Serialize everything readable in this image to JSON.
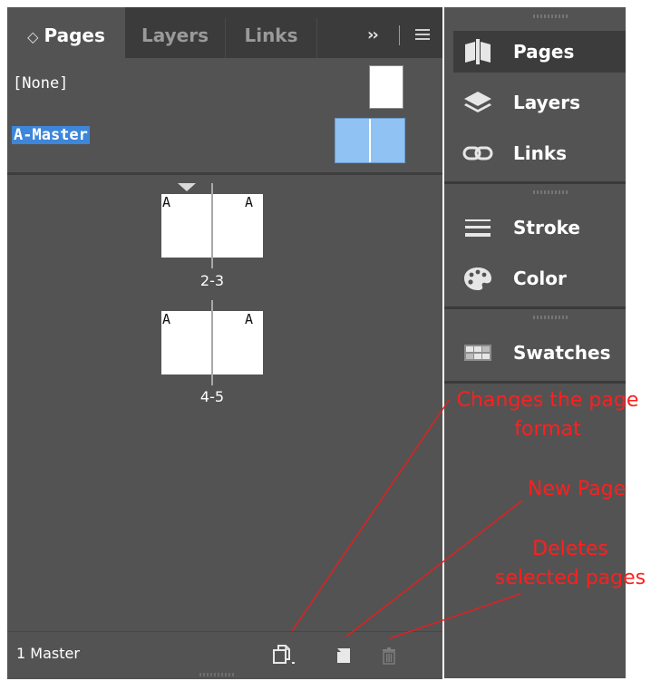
{
  "tabs": [
    {
      "label": "Pages",
      "active": true
    },
    {
      "label": "Layers",
      "active": false
    },
    {
      "label": "Links",
      "active": false
    }
  ],
  "tab_overflow": "››",
  "masters": {
    "none_label": "[None]",
    "master_label": "A-Master"
  },
  "spreads": [
    {
      "label": "2-3",
      "left_letter": "A",
      "right_letter": "A"
    },
    {
      "label": "4-5",
      "left_letter": "A",
      "right_letter": "A"
    }
  ],
  "status": {
    "text": "1 Master"
  },
  "dock": {
    "items": [
      {
        "label": "Pages",
        "icon": "pages-icon",
        "active": true
      },
      {
        "label": "Layers",
        "icon": "layers-icon",
        "active": false
      },
      {
        "label": "Links",
        "icon": "links-icon",
        "active": false
      },
      {
        "label": "Stroke",
        "icon": "stroke-icon",
        "active": false
      },
      {
        "label": "Color",
        "icon": "color-palette-icon",
        "active": false
      },
      {
        "label": "Swatches",
        "icon": "swatches-icon",
        "active": false
      }
    ]
  },
  "annotations": {
    "page_format": [
      "Changes the page",
      "format"
    ],
    "new_page": "New Page",
    "delete_pages": [
      "Deletes",
      "selected pages"
    ]
  },
  "colors": {
    "panel": "#535353",
    "tabbar": "#3b3b3b",
    "selection": "#3d86d9",
    "master_thumb": "#90c2f3",
    "annotation": "#ff1f1f"
  }
}
